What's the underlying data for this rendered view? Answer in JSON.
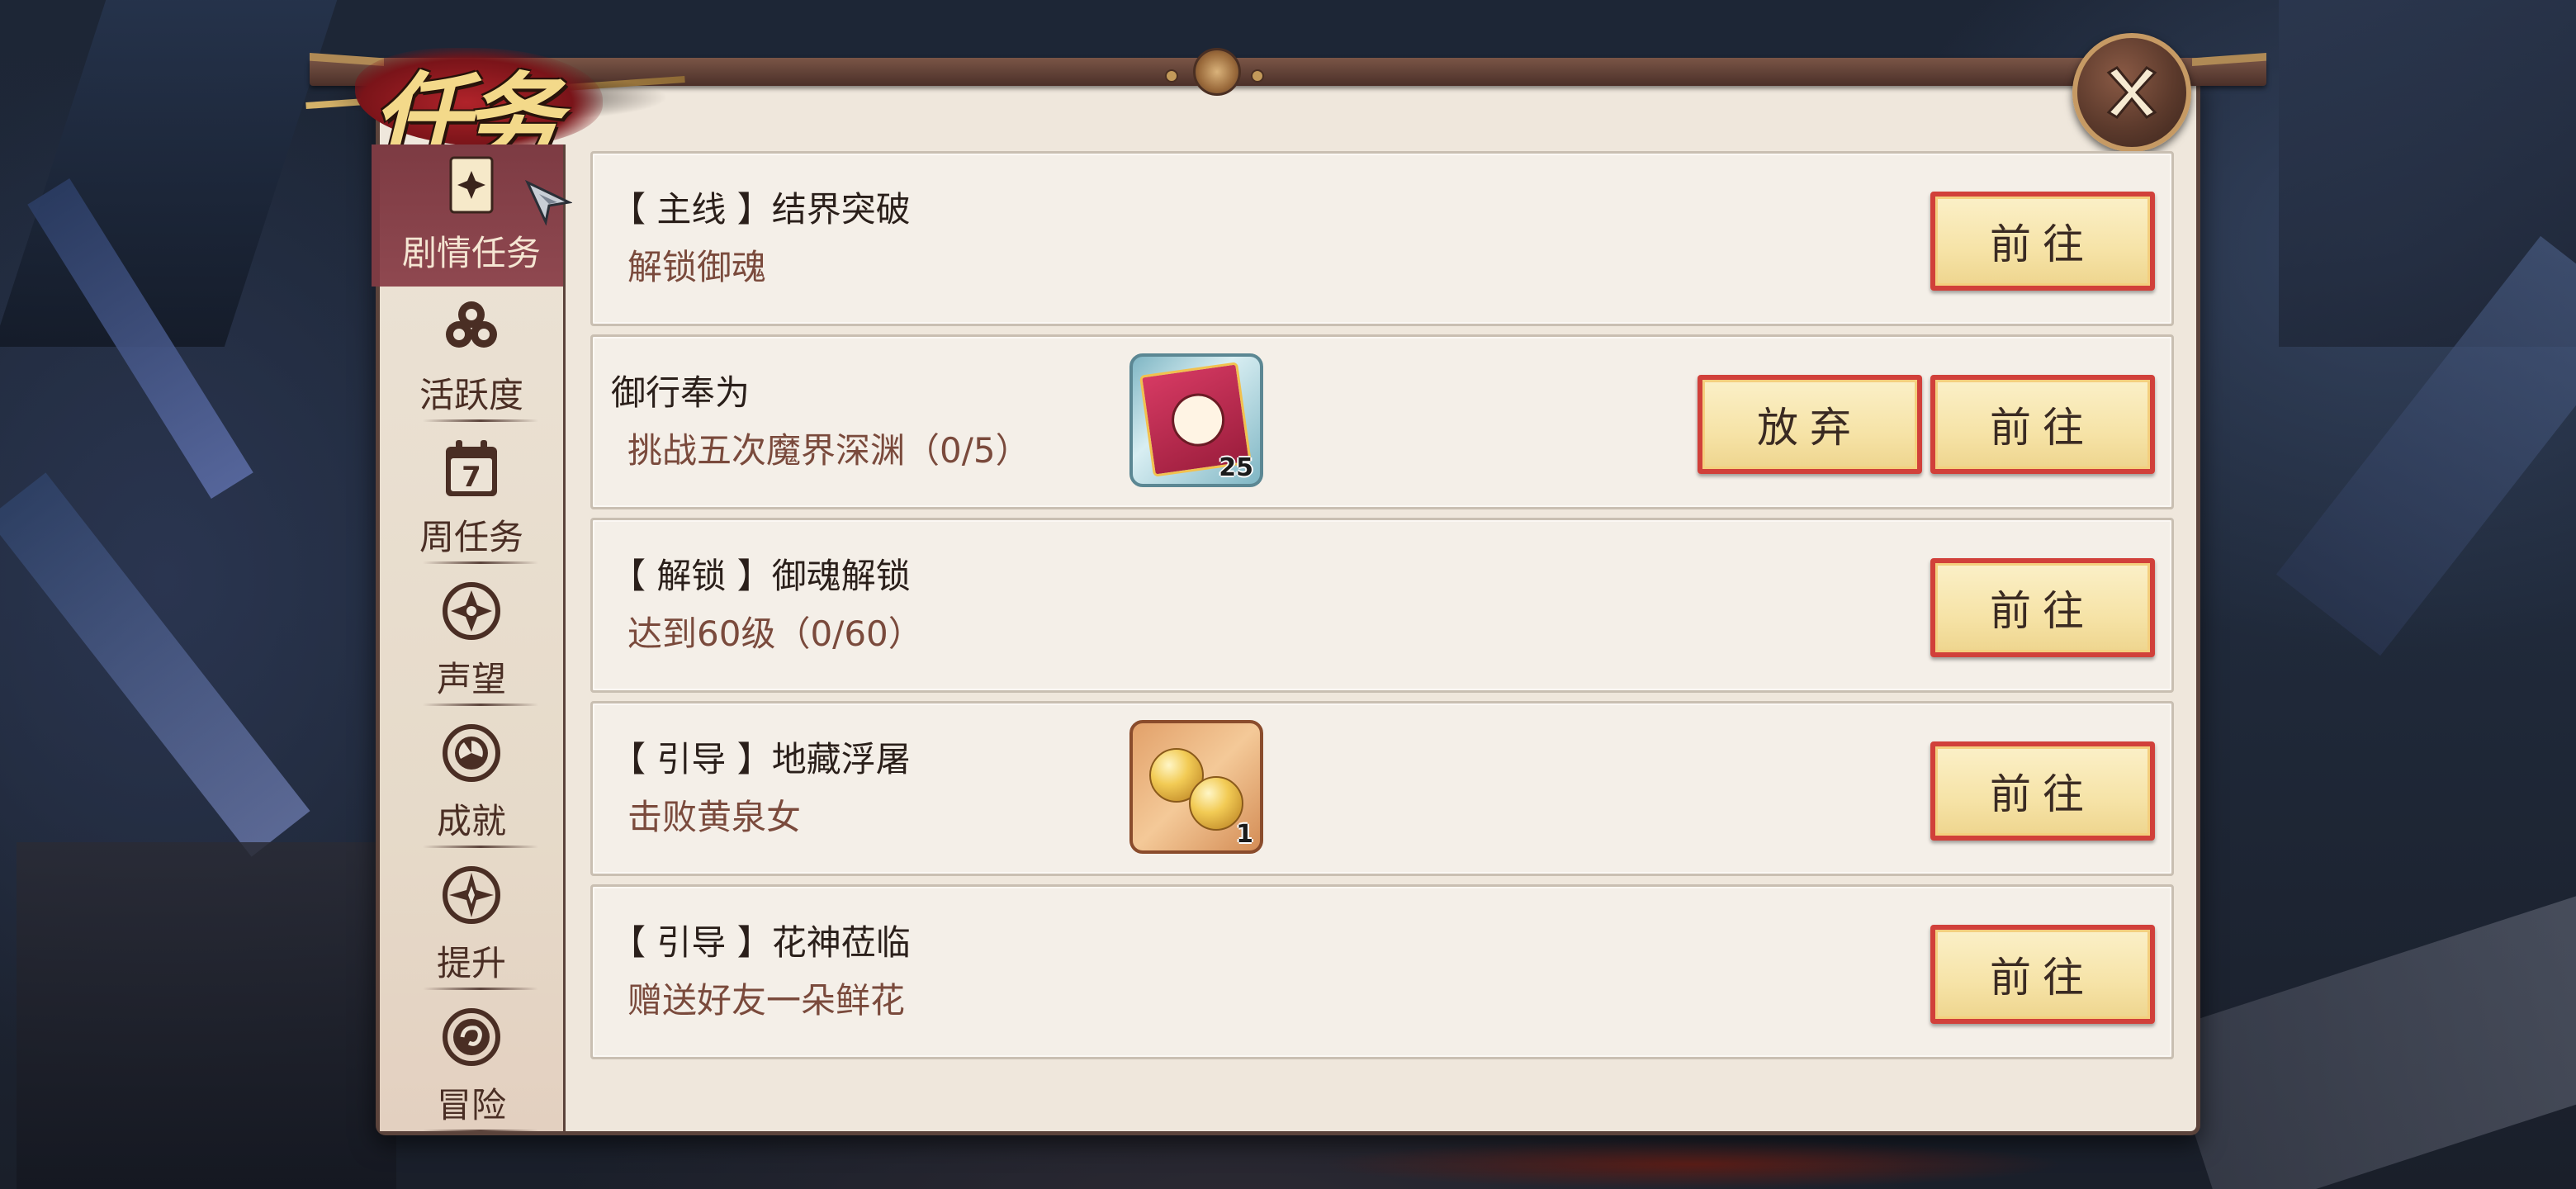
{
  "window": {
    "title": "任务"
  },
  "sidebar": {
    "items": [
      {
        "label": "剧情任务",
        "icon": "scroll-card-icon",
        "active": true
      },
      {
        "label": "活跃度",
        "icon": "clover-icon",
        "active": false
      },
      {
        "label": "周任务",
        "icon": "calendar-icon",
        "calendar_day": "7",
        "active": false
      },
      {
        "label": "声望",
        "icon": "crest-icon",
        "active": false
      },
      {
        "label": "成就",
        "icon": "swirl-crest-icon",
        "active": false
      },
      {
        "label": "提升",
        "icon": "star-crest-icon",
        "active": false
      },
      {
        "label": "冒险",
        "icon": "spiral-crest-icon",
        "active": false
      }
    ]
  },
  "tasks": [
    {
      "title": "【 主线 】结界突破",
      "desc": "解锁御魂",
      "go_label": "前往"
    },
    {
      "title": "御行奉为",
      "desc": "挑战五次魔界深渊（0/5）",
      "reward": {
        "icon": "ticket-icon",
        "count": "25"
      },
      "abandon_label": "放弃",
      "go_label": "前往"
    },
    {
      "title": "【 解锁 】御魂解锁",
      "desc": "达到60级（0/60）",
      "go_label": "前往"
    },
    {
      "title": "【 引导 】地藏浮屠",
      "desc": "击败黄泉女",
      "reward": {
        "icon": "gold-orb-icon",
        "count": "1"
      },
      "go_label": "前往"
    },
    {
      "title": "【 引导 】花神莅临",
      "desc": "赠送好友一朵鲜花",
      "go_label": "前往"
    }
  ],
  "colors": {
    "panel_bg": "#efe7dc",
    "frame": "#5b433b",
    "button_border": "#d1403a",
    "button_fill": "#f6e3a7",
    "active_tab": "#7d3b43",
    "title_gold": "#f3d98a"
  }
}
